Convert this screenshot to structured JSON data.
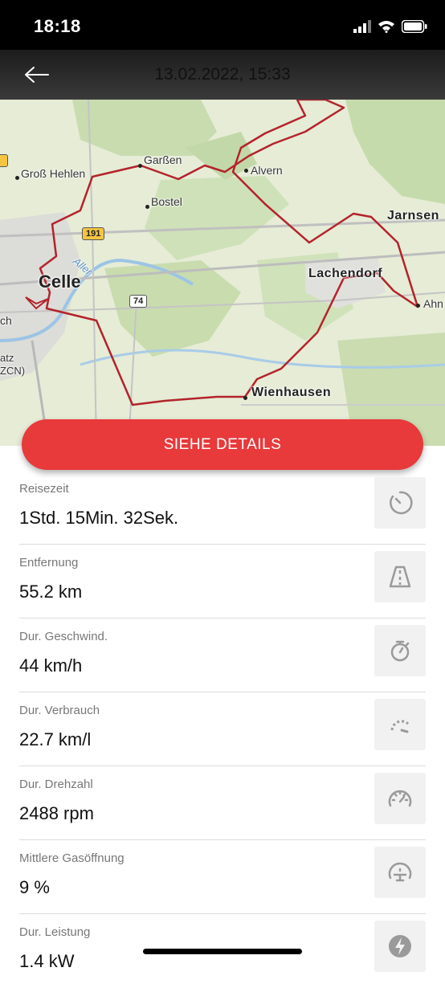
{
  "status_bar": {
    "time": "18:18"
  },
  "header": {
    "title": "13.02.2022, 15:33"
  },
  "map": {
    "places": {
      "gross_hehlen": "Groß Hehlen",
      "garssen": "Garßen",
      "alvern": "Alvern",
      "bostel": "Bostel",
      "jarnsen": "Jarnsen",
      "celle": "Celle",
      "lachendorf": "Lachendorf",
      "ahn": "Ahn",
      "wienhausen": "Wienhausen",
      "aller": "Aller",
      "ch_partial": "ch",
      "atz_partial": "atz",
      "zcn_partial": "ZCN)"
    },
    "road_191": "191",
    "road_74": "74"
  },
  "details_button": "SIEHE DETAILS",
  "metrics": [
    {
      "label": "Reisezeit",
      "value": "1Std. 15Min. 32Sek.",
      "icon": "clock-icon"
    },
    {
      "label": "Entfernung",
      "value": "55.2 km",
      "icon": "road-icon"
    },
    {
      "label": "Dur. Geschwind.",
      "value": "44 km/h",
      "icon": "stopwatch-icon"
    },
    {
      "label": "Dur. Verbrauch",
      "value": "22.7 km/l",
      "icon": "fuel-gauge-icon"
    },
    {
      "label": "Dur. Drehzahl",
      "value": "2488 rpm",
      "icon": "tachometer-icon"
    },
    {
      "label": "Mittlere Gasöffnung",
      "value": "9 %",
      "icon": "throttle-icon"
    },
    {
      "label": "Dur. Leistung",
      "value": "1.4 kW",
      "icon": "power-icon"
    }
  ],
  "colors": {
    "accent": "#e8393b",
    "route": "#b3232b",
    "header": "#2b2b2b"
  }
}
